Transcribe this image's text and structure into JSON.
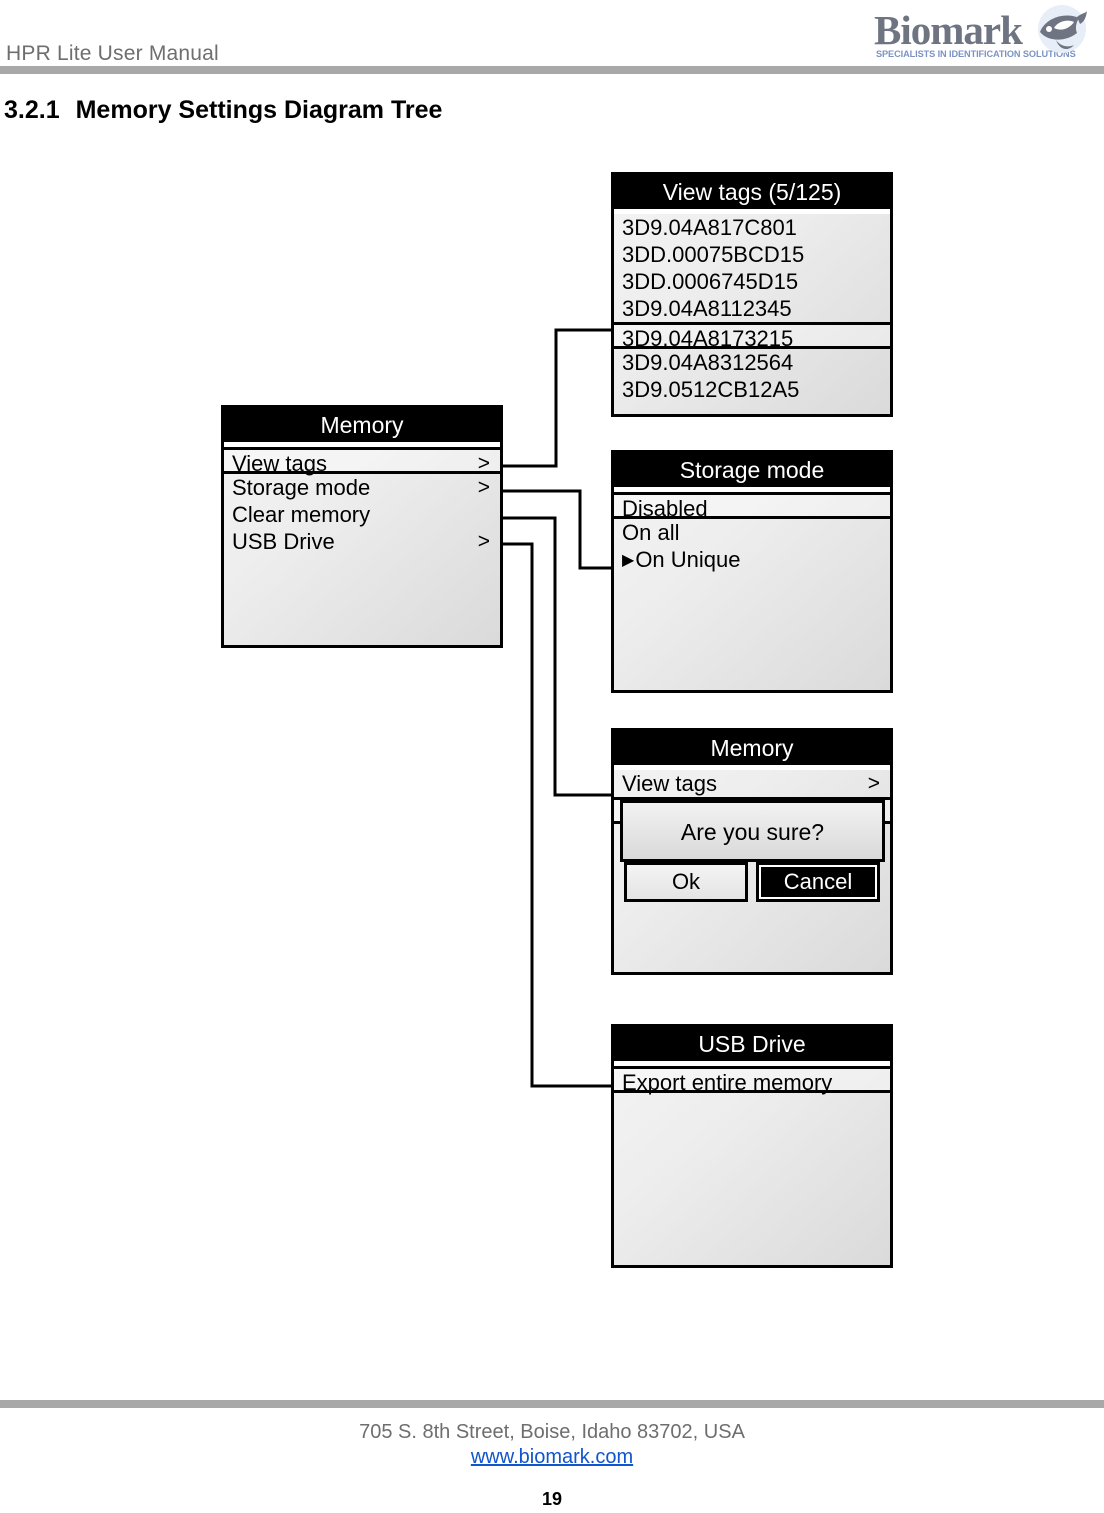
{
  "header": {
    "manual_title": "HPR Lite User Manual",
    "logo_word": "Biomark",
    "logo_tagline": "SPECIALISTS IN IDENTIFICATION SOLUTIONS",
    "logo_icon": "fish-icon",
    "rule_color": "#a8a8a8"
  },
  "section": {
    "number": "3.2.1",
    "title": "Memory Settings Diagram Tree"
  },
  "screens": {
    "view_tags": {
      "title": "View tags (5/125)",
      "rows": [
        "3D9.04A817C801",
        "3DD.00075BCD15",
        "3DD.0006745D15",
        "3D9.04A8112345",
        "3D9.04A8173215",
        "3D9.04A8312564",
        "3D9.0512CB12A5"
      ],
      "selected_index": 4
    },
    "memory_menu": {
      "title": "Memory",
      "rows": [
        {
          "label": "View tags",
          "chevron": ">"
        },
        {
          "label": "Storage mode",
          "chevron": ">"
        },
        {
          "label": "Clear memory",
          "chevron": ""
        },
        {
          "label": "USB Drive",
          "chevron": ">"
        }
      ],
      "selected_index": 0
    },
    "storage_mode": {
      "title": "Storage mode",
      "rows": [
        {
          "label": "Disabled",
          "marker": false
        },
        {
          "label": "On all",
          "marker": false
        },
        {
          "label": "On Unique",
          "marker": true
        }
      ],
      "selected_index": 0
    },
    "clear_memory": {
      "title": "Memory",
      "rows": [
        {
          "label": "View tags",
          "chevron": ">"
        }
      ],
      "dialog": {
        "message": "Are you sure?",
        "ok_label": "Ok",
        "cancel_label": "Cancel",
        "selected_button": "Cancel"
      }
    },
    "usb_drive": {
      "title": "USB Drive",
      "rows": [
        "Export entire memory"
      ],
      "selected_index": 0
    }
  },
  "footer": {
    "address": "705 S. 8th Street, Boise, Idaho 83702, USA",
    "website": "www.biomark.com",
    "page_number": "19"
  }
}
